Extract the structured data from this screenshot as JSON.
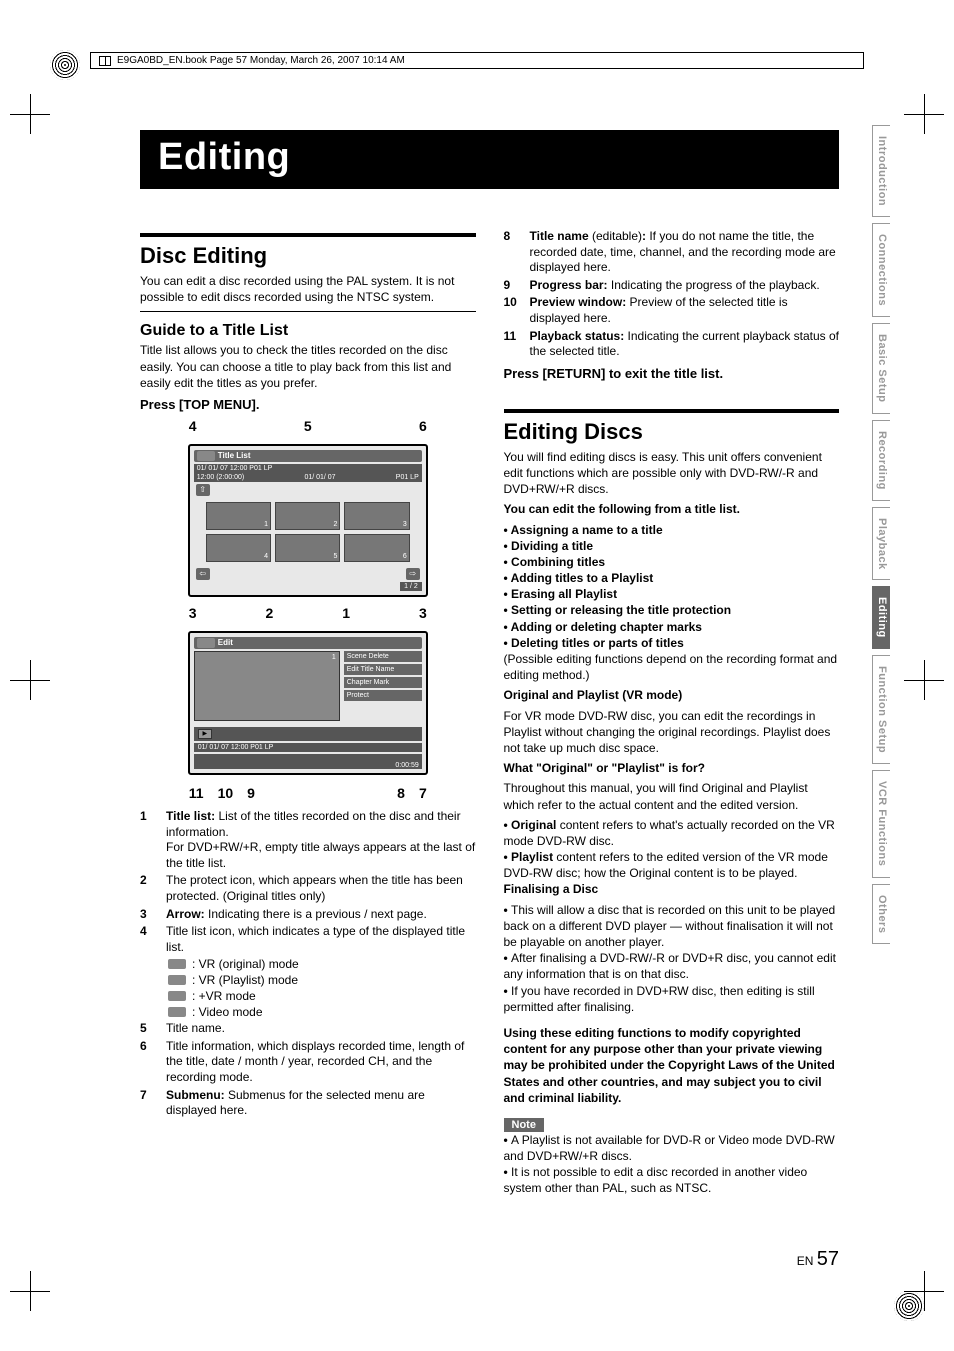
{
  "header_line": "E9GA0BD_EN.book  Page 57  Monday, March 26, 2007  10:14 AM",
  "page_title": "Editing",
  "left": {
    "h2": "Disc Editing",
    "intro": "You can edit a disc recorded using the PAL system. It is not possible to edit discs recorded using the NTSC system.",
    "h3_guide": "Guide to a Title List",
    "guide_p": "Title list allows you to check the titles recorded on the disc easily. You can choose a title to play back from this list and easily edit the titles as you prefer.",
    "instr1": "Press [TOP MENU].",
    "callout_top": [
      "4",
      "5",
      "6"
    ],
    "fig1": {
      "title": "Title List",
      "row1": "01/ 01/ 07 12:00  P01  LP",
      "row2_left": "12:00 (2:00:00)",
      "row2_mid": "01/ 01/ 07",
      "row2_right": "P01 LP",
      "pager": "1 / 2"
    },
    "callout_mid": [
      "3",
      "2",
      "1",
      "3"
    ],
    "fig2": {
      "title": "Edit",
      "menu": [
        "Scene Delete",
        "Edit Title Name",
        "Chapter Mark",
        "Protect"
      ],
      "info": "01/ 01/ 07 12:00  P01  LP",
      "time": "0:00:59",
      "thumb_n": "1"
    },
    "callout_bot": [
      "11",
      "10",
      "9",
      "8",
      "7"
    ],
    "defs": [
      {
        "n": "1",
        "html": "<span class='b'>Title list:</span> List of the titles recorded on the disc and their information.<br>For DVD+RW/+R, empty title always appears at the last of the title list."
      },
      {
        "n": "2",
        "html": "The protect icon, which appears when the title has been protected. (Original titles only)"
      },
      {
        "n": "3",
        "html": "<span class='b'>Arrow:</span> Indicating there is a previous / next page."
      },
      {
        "n": "4",
        "html": "Title list icon, which indicates a type of the displayed title list."
      }
    ],
    "modes": [
      ": VR (original) mode",
      ": VR (Playlist) mode",
      ": +VR mode",
      ": Video mode"
    ],
    "defs2": [
      {
        "n": "5",
        "html": "Title name."
      },
      {
        "n": "6",
        "html": "Title information, which displays recorded time, length of the title, date / month / year, recorded CH, and the recording mode."
      },
      {
        "n": "7",
        "html": "<span class='b'>Submenu:</span> Submenus for the selected menu are displayed here."
      }
    ]
  },
  "right": {
    "defs3": [
      {
        "n": "8",
        "html": "<span class='b'>Title name</span> (editable)<span class='b'>:</span> If you do not name the title, the recorded date, time, channel, and the recording mode are displayed here."
      },
      {
        "n": "9",
        "html": "<span class='b'>Progress bar:</span> Indicating the progress of the playback."
      },
      {
        "n": "10",
        "html": "<span class='b'>Preview window:</span> Preview of the selected title is displayed here."
      },
      {
        "n": "11",
        "html": "<span class='b'>Playback status:</span> Indicating the current playback status of the selected title."
      }
    ],
    "instr_return": "Press [RETURN] to exit the title list.",
    "h2": "Editing Discs",
    "intro": "You will find editing discs is easy. This unit offers convenient edit functions which are possible only with DVD-RW/-R and DVD+RW/+R discs.",
    "can_edit": "You can edit the following from a title list.",
    "bullets": [
      "Assigning a name to a title",
      "Dividing a title",
      "Combining titles",
      "Adding titles to a Playlist",
      "Erasing all Playlist",
      "Setting or releasing the title protection",
      "Adding or deleting chapter marks",
      "Deleting titles or parts of titles"
    ],
    "possible": "(Possible editing functions depend on the recording format and editing method.)",
    "orig_h": "Original and Playlist (VR mode)",
    "orig_p": "For VR mode DVD-RW disc, you can edit the recordings in Playlist without changing the original recordings. Playlist does not take up much disc space.",
    "what_h": "What \"Original\" or \"Playlist\" is for?",
    "what_p": "Throughout this manual, you will find Original and Playlist which refer to the actual content and the edited version.",
    "op_bullets": [
      "<span class='b'>Original</span> content refers to what's actually recorded on the VR mode DVD-RW disc.",
      "<span class='b'>Playlist</span> content refers to the edited version of the VR mode DVD-RW disc; how the Original content is to be played."
    ],
    "fin_h": "Finalising a Disc",
    "fin_bullets": [
      "This will allow a disc that is recorded on this unit to be played back on a different DVD player — without finalisation it will not be playable on another player.",
      "After finalising a DVD-RW/-R or DVD+R disc, you cannot edit any information that is on that disc.",
      "If you have recorded in DVD+RW disc, then editing is still permitted after finalising."
    ],
    "warn": "Using these editing functions to modify copyrighted content for any purpose other than your private viewing may be prohibited under the Copyright Laws of the United States and other countries, and may subject you to civil and criminal liability.",
    "note_label": "Note",
    "notes": [
      "A Playlist is not available for DVD-R or Video mode DVD-RW and DVD+RW/+R discs.",
      "It is not possible to edit a disc recorded in another video system other than PAL, such as NTSC."
    ]
  },
  "tabs": [
    "Introduction",
    "Connections",
    "Basic Setup",
    "Recording",
    "Playback",
    "Editing",
    "Function Setup",
    "VCR Functions",
    "Others"
  ],
  "active_tab": "Editing",
  "footer_lang": "EN",
  "footer_pn": "57"
}
